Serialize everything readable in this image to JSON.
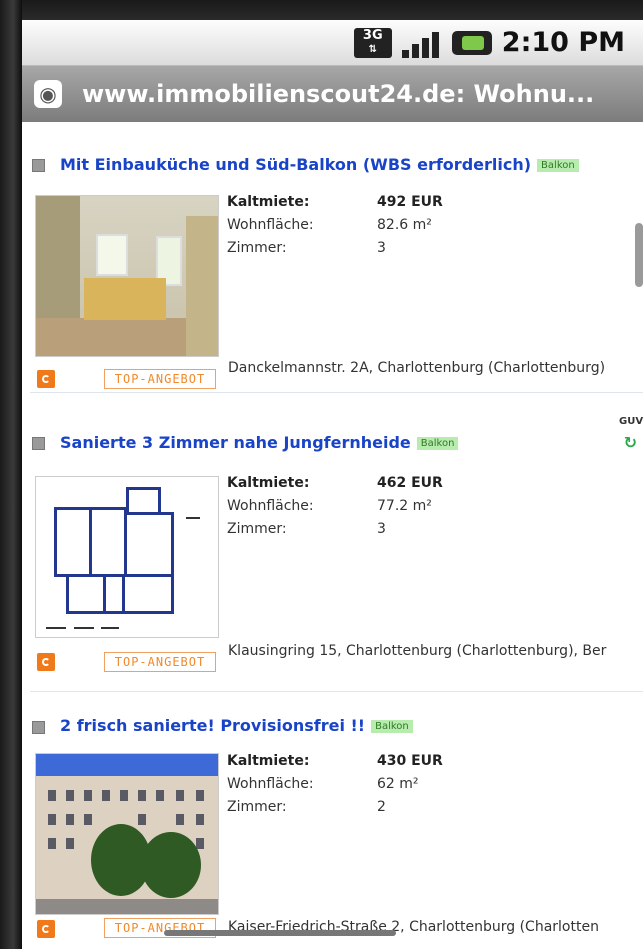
{
  "status_bar": {
    "network": "3G",
    "time": "2:10 PM"
  },
  "browser": {
    "title": "www.immobilienscout24.de: Wohnu..."
  },
  "labels": {
    "kaltmiete": "Kaltmiete:",
    "wohnflaeche": "Wohnfläche:",
    "zimmer": "Zimmer:",
    "top_angebot": "TOP-ANGEBOT"
  },
  "listings": [
    {
      "title": "Mit Einbauküche und Süd-Balkon (WBS erforderlich)",
      "badge": "Balkon",
      "kaltmiete": "492 EUR",
      "wohnflaeche": "82.6 m²",
      "zimmer": "3",
      "address": "Danckelmannstr. 2A, Charlottenburg (Charlottenburg)"
    },
    {
      "title": "Sanierte 3 Zimmer nahe Jungfernheide",
      "badge": "Balkon",
      "kaltmiete": "462 EUR",
      "wohnflaeche": "77.2 m²",
      "zimmer": "3",
      "address": "Klausingring 15, Charlottenburg (Charlottenburg), Ber"
    },
    {
      "title": "2 frisch sanierte! Provisionsfrei !!",
      "badge": "Balkon",
      "kaltmiete": "430 EUR",
      "wohnflaeche": "62 m²",
      "zimmer": "2",
      "address": "Kaiser-Friedrich-Straße 2, Charlottenburg (Charlotten"
    }
  ],
  "side_logo": {
    "text": "GUV"
  }
}
